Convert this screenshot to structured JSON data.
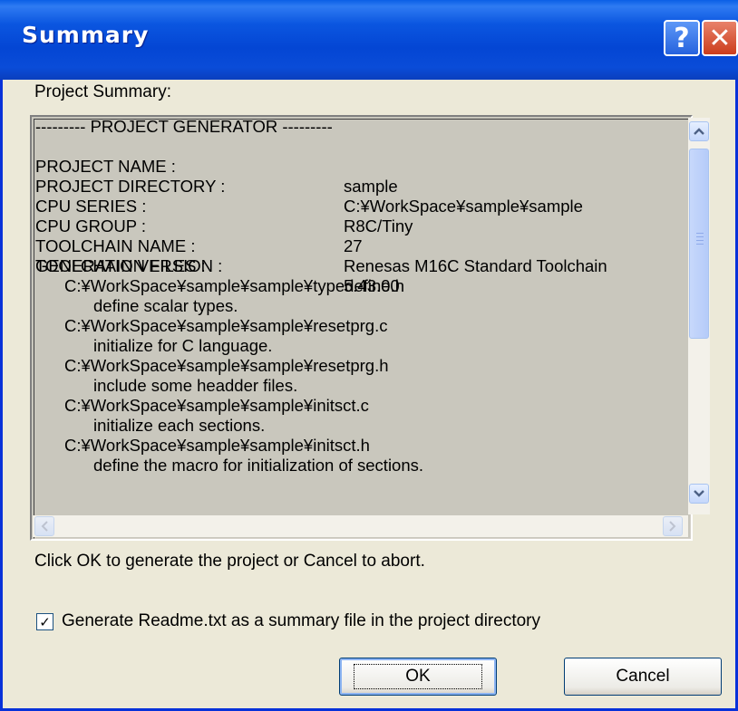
{
  "window": {
    "title": "Summary",
    "help_glyph": "?",
    "close_glyph": "✕"
  },
  "summary_label": "Project Summary:",
  "summary": {
    "header": "--------- PROJECT GENERATOR ---------",
    "fields": [
      {
        "key": "PROJECT NAME :",
        "value": "sample"
      },
      {
        "key": "PROJECT DIRECTORY :",
        "value": "C:¥WorkSpace¥sample¥sample"
      },
      {
        "key": "CPU SERIES :",
        "value": "R8C/Tiny"
      },
      {
        "key": "CPU GROUP :",
        "value": "27"
      },
      {
        "key": "TOOLCHAIN NAME :",
        "value": "Renesas M16C Standard Toolchain"
      },
      {
        "key": "TOOLCHAIN VERSION :",
        "value": "5.43.00"
      }
    ],
    "files_label": "GENERATION FILES :",
    "files": [
      {
        "path": "C:¥WorkSpace¥sample¥sample¥typedefine.h",
        "desc": "define scalar types."
      },
      {
        "path": "C:¥WorkSpace¥sample¥sample¥resetprg.c",
        "desc": "initialize for C language."
      },
      {
        "path": "C:¥WorkSpace¥sample¥sample¥resetprg.h",
        "desc": "include some headder files."
      },
      {
        "path": "C:¥WorkSpace¥sample¥sample¥initsct.c",
        "desc": "initialize each sections."
      },
      {
        "path": "C:¥WorkSpace¥sample¥sample¥initsct.h",
        "desc": "define the macro for initialization of sections."
      }
    ]
  },
  "footer_text": "Click OK to generate the project or Cancel to abort.",
  "readme_checkbox": {
    "checked": true,
    "glyph": "✓",
    "label": "Generate Readme.txt as a summary file in the project directory"
  },
  "buttons": {
    "ok": "OK",
    "cancel": "Cancel"
  },
  "icons": {
    "scroll_up": "up-arrow-icon",
    "scroll_down": "down-arrow-icon",
    "scroll_left": "left-arrow-icon",
    "scroll_right": "right-arrow-icon"
  },
  "colors": {
    "titlebar": "#0446d4",
    "dialog_bg": "#ece9d8",
    "textbox_bg": "#c9c7bd",
    "close_button": "#cc3d1c"
  }
}
